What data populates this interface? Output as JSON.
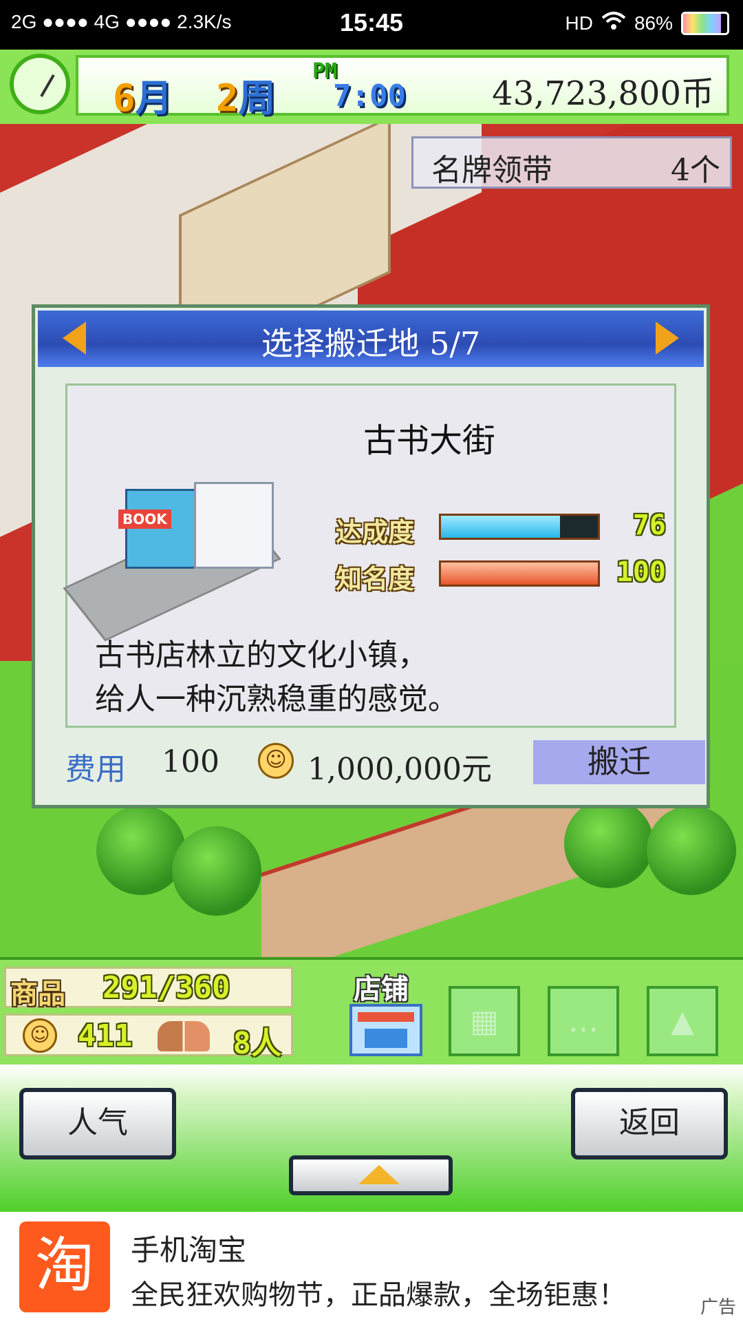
{
  "status_bar": {
    "network": "2G ●●●● 4G ●●●● 2.3K/s",
    "time": "15:45",
    "hd": "HD",
    "battery": "86%",
    "battery_level": 0.86
  },
  "hud": {
    "month_num": "6",
    "month_unit": "月",
    "week_num": "2",
    "week_unit": "周",
    "ampm": "PM",
    "time": "7:00",
    "money": "43,723,800币"
  },
  "item_badge": {
    "name": "名牌领带",
    "count": "4个"
  },
  "dialog": {
    "title": "选择搬迁地 5/7",
    "district_name": "古书大街",
    "building_sign": "BOOK",
    "stats": [
      {
        "label": "达成度",
        "value": "76",
        "level": 0.76
      },
      {
        "label": "知名度",
        "value": "100",
        "level": 1.0
      }
    ],
    "description_line1": "古书店林立的文化小镇，",
    "description_line2": "给人一种沉熟稳重的感觉。",
    "cost_label": "费用",
    "cost_points": "100",
    "cost_money": "1,000,000元",
    "move_button": "搬迁"
  },
  "bottom_hud": {
    "goods_label": "商品",
    "goods_value": "291/360",
    "popularity": "411",
    "staff": "8人",
    "store_label": "店铺"
  },
  "nav": {
    "left_button": "人气",
    "right_button": "返回"
  },
  "ad": {
    "logo": "淘",
    "title": "手机淘宝",
    "text": "全民狂欢购物节，正品爆款，全场钜惠！",
    "tag": "广告"
  }
}
